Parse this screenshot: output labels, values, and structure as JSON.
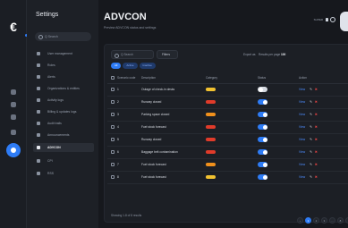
{
  "app": {
    "logo": "€"
  },
  "sidebar": {
    "title": "Settings",
    "search_placeholder": "Q Search",
    "items": [
      {
        "label": "User management"
      },
      {
        "label": "Roles"
      },
      {
        "label": "Alerts"
      },
      {
        "label": "Organizations & entities"
      },
      {
        "label": "Activity logs"
      },
      {
        "label": "Billing & updates logs"
      },
      {
        "label": "Audit trails"
      },
      {
        "label": "Announcements"
      },
      {
        "label": "ADVCON"
      },
      {
        "label": "CPI"
      },
      {
        "label": "RSS"
      }
    ]
  },
  "header": {
    "title": "ADVCON",
    "subtitle": "Preview ADVCON status and settings",
    "user_label": "SUPER"
  },
  "toolbar": {
    "search_placeholder": "Q Search",
    "filters_label": "Filters",
    "export_label": "Export as",
    "results_label": "Results per page",
    "results_value": "100"
  },
  "chips": [
    "All",
    "Active",
    "Inactive"
  ],
  "table": {
    "headers": [
      "Scenario code",
      "Description",
      "Category",
      "Status",
      "Action"
    ],
    "rows": [
      {
        "code": "1",
        "description": "Outage of check-in desks",
        "category_color": "#f2c230",
        "active": false
      },
      {
        "code": "2",
        "description": "Runway closed",
        "category_color": "#e03b2a",
        "active": true
      },
      {
        "code": "3",
        "description": "Parking space closed",
        "category_color": "#f0901c",
        "active": true
      },
      {
        "code": "4",
        "description": "Fuel stock forecast",
        "category_color": "#e03b2a",
        "active": true
      },
      {
        "code": "5",
        "description": "Runway closed",
        "category_color": "#e03b2a",
        "active": true
      },
      {
        "code": "6",
        "description": "Baggage belt contamination",
        "category_color": "#e03b2a",
        "active": true
      },
      {
        "code": "7",
        "description": "Fuel stock forecast",
        "category_color": "#f0901c",
        "active": true
      },
      {
        "code": "8",
        "description": "Fuel stock forecast",
        "category_color": "#f2c230",
        "active": true
      }
    ],
    "actions": {
      "view": "View",
      "edit": "✎",
      "delete": "✖"
    }
  },
  "footer": {
    "showing": "Showing 1-8 of 8 results",
    "pages": [
      "‹",
      "1",
      "2",
      "3",
      "…",
      "8",
      "›"
    ]
  }
}
